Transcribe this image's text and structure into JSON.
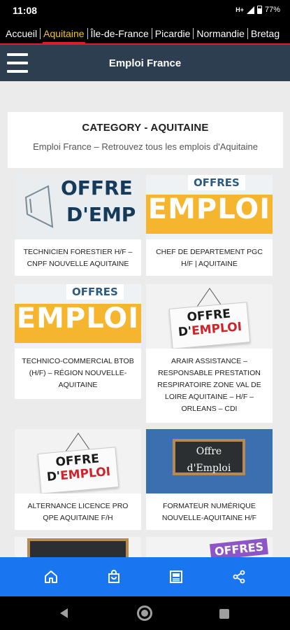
{
  "status_bar": {
    "time": "11:08",
    "network": "H+",
    "battery": "77%"
  },
  "tabs": [
    {
      "label": "Accueil",
      "active": false
    },
    {
      "label": "Aquitaine",
      "active": true
    },
    {
      "label": "Île-de-France",
      "active": false
    },
    {
      "label": "Picardie",
      "active": false
    },
    {
      "label": "Normandie",
      "active": false
    },
    {
      "label": "Bretag",
      "active": false
    }
  ],
  "header": {
    "title": "Emploi France",
    "menu_icon": "hamburger-menu-icon"
  },
  "category": {
    "title": "CATEGORY - AQUITAINE",
    "subtitle": "Emploi France – Retrouvez tous les emplois d'Aquitaine"
  },
  "posts": [
    {
      "caption": "TECHNICIEN FORESTIER H/F – CNPF NOUVELLE AQUITAINE",
      "thumb": "offre-emploi-megaphone",
      "thumb_text": [
        "OFFRE",
        "D'EMP"
      ]
    },
    {
      "caption": "CHEF DE DEPARTEMENT PGC H/F | AQUITAINE",
      "thumb": "offres-emploi-yellow",
      "thumb_text": [
        "OFFRES",
        "EMPLOI"
      ]
    },
    {
      "caption": "TECHNICO-COMMERCIAL BTOB (H/F) – RÉGION NOUVELLE-AQUITAINE",
      "thumb": "offres-emploi-yellow",
      "thumb_text": [
        "OFFRES",
        "EMPLOI"
      ]
    },
    {
      "caption": "ARAIR ASSISTANCE – RESPONSABLE PRESTATION RESPIRATOIRE ZONE VAL DE LOIRE AQUITAINE – H/F – ORLEANS – CDI",
      "thumb": "offre-emploi-sign",
      "thumb_text": [
        "OFFRE",
        "D'",
        "EMPLOI"
      ]
    },
    {
      "caption": "ALTERNANCE LICENCE PRO QPE AQUITAINE F/H",
      "thumb": "offre-emploi-sign",
      "thumb_text": [
        "OFFRE",
        "D'",
        "EMPLOI"
      ]
    },
    {
      "caption": "FORMATEUR NUMÉRIQUE NOUVELLE-AQUITAINE H/F",
      "thumb": "offre-emploi-chalkboard",
      "thumb_text": [
        "Offre",
        "d'Emploi"
      ]
    },
    {
      "caption": "",
      "thumb": "chalkboard-partial",
      "thumb_text": []
    },
    {
      "caption": "",
      "thumb": "offres-purple-partial",
      "thumb_text": [
        "OFFRES"
      ]
    }
  ],
  "bottom_nav": [
    {
      "icon": "home-icon"
    },
    {
      "icon": "shopping-bag-icon"
    },
    {
      "icon": "newspaper-icon"
    },
    {
      "icon": "share-icon"
    }
  ],
  "colors": {
    "tab_active": "#f5c518",
    "tab_underline": "#e31b23",
    "header_bg": "#2d3e50",
    "bottom_nav_bg": "#1976f0",
    "offre_yellow": "#f6b52e"
  }
}
